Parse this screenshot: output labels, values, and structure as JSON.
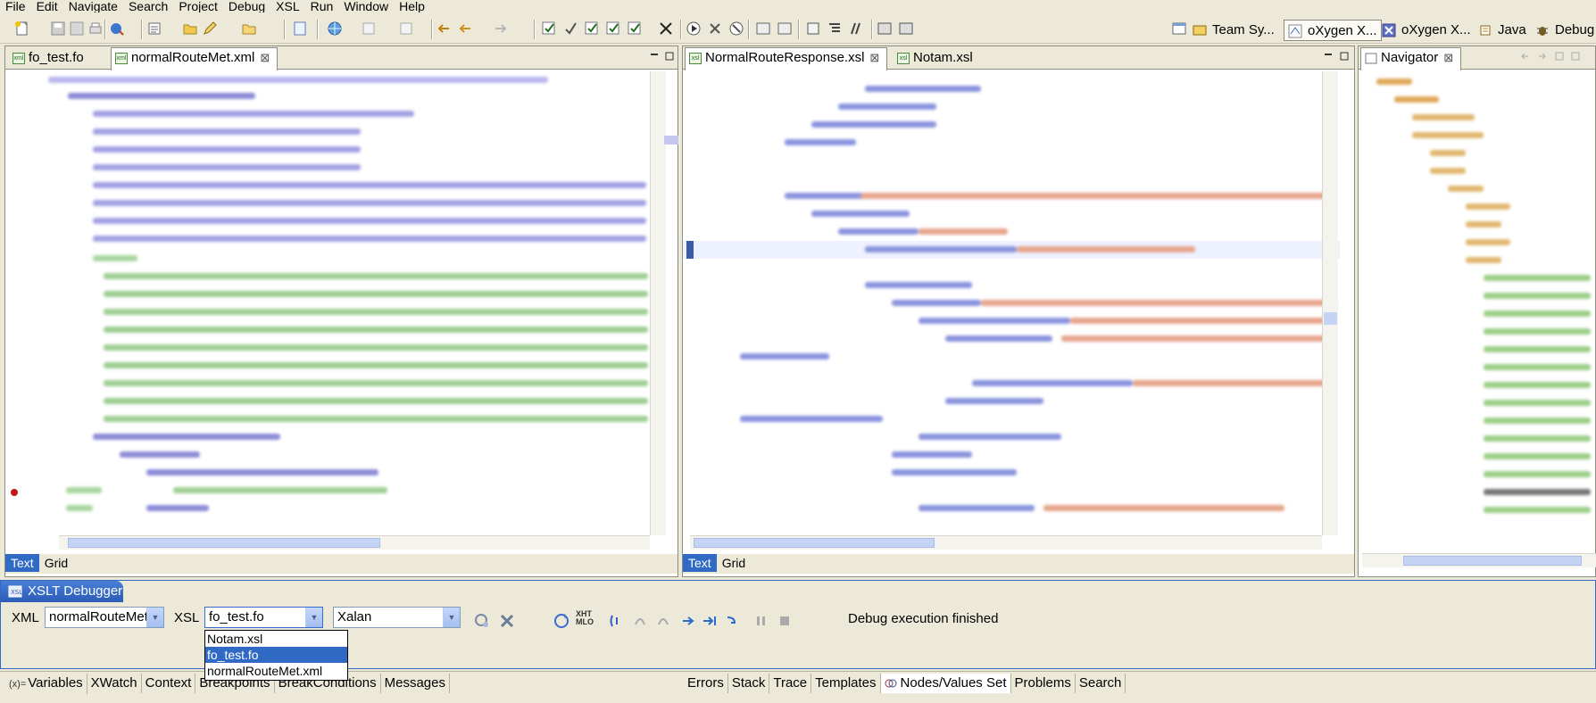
{
  "menu": [
    "File",
    "Edit",
    "Navigate",
    "Search",
    "Project",
    "Debug",
    "XSL",
    "Run",
    "Window",
    "Help"
  ],
  "perspectives": [
    {
      "label": "Team Sy...",
      "active": false
    },
    {
      "label": "oXygen X...",
      "active": true
    },
    {
      "label": "oXygen X...",
      "active": false
    },
    {
      "label": "Java",
      "active": false
    },
    {
      "label": "Debug",
      "active": false
    }
  ],
  "editor_left": {
    "tabs": [
      {
        "label": "fo_test.fo",
        "active": false
      },
      {
        "label": "normalRouteMet.xml",
        "active": true,
        "close": "⊠"
      }
    ],
    "mode_tabs": [
      "Text",
      "Grid"
    ]
  },
  "editor_mid": {
    "tabs": [
      {
        "label": "NormalRouteResponse.xsl",
        "active": true,
        "close": "⊠"
      },
      {
        "label": "Notam.xsl",
        "active": false
      }
    ],
    "mode_tabs": [
      "Text",
      "Grid"
    ]
  },
  "navigator": {
    "title": "Navigator",
    "close": "⊠"
  },
  "debugger": {
    "title": "XSLT Debugger",
    "xml_label": "XML",
    "xml_value": "normalRouteMet.xml",
    "xsl_label": "XSL",
    "xsl_value": "fo_test.fo",
    "processor": "Xalan",
    "status": "Debug execution finished",
    "xhtml_icon": "XHT MLO",
    "dropdown_options": [
      "Notam.xsl",
      "fo_test.fo",
      "normalRouteMet.xml"
    ],
    "dropdown_selected": "fo_test.fo"
  },
  "lower_left_tabs": [
    "Variables",
    "XWatch",
    "Context",
    "Breakpoints",
    "BreakConditions",
    "Messages"
  ],
  "lower_left_prefix": "(x)=",
  "lower_right_tabs": [
    "Errors",
    "Stack",
    "Trace",
    "Templates",
    "Nodes/Values Set",
    "Problems",
    "Search"
  ]
}
